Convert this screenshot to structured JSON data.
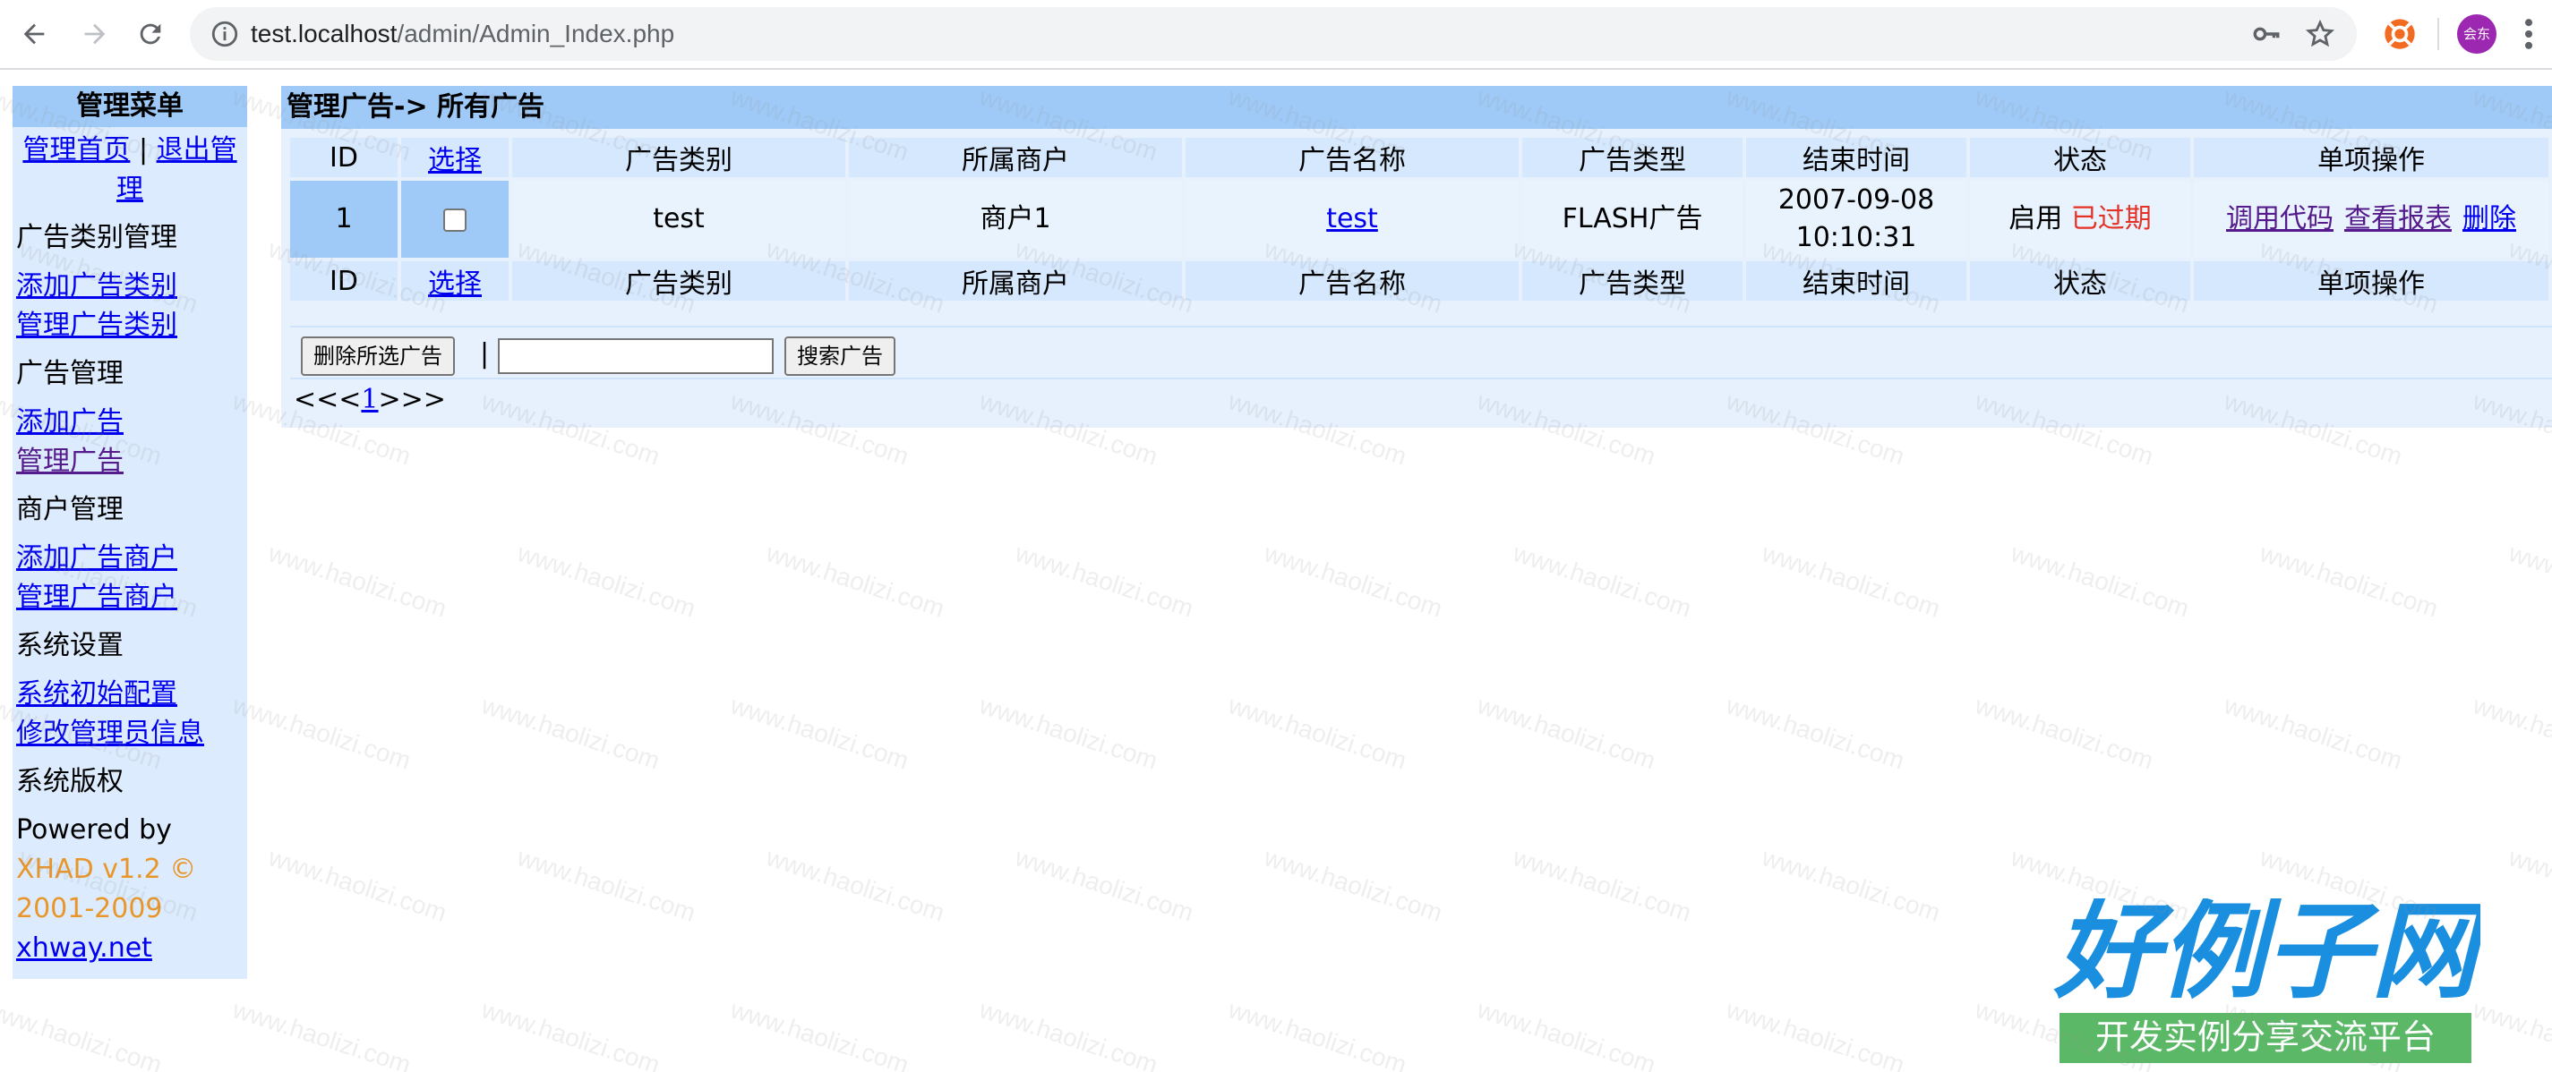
{
  "browser": {
    "url_host": "test.localhost",
    "url_path": "/admin/Admin_Index.php",
    "avatar_text": "会东",
    "icons": [
      "back-icon",
      "forward-icon",
      "reload-icon",
      "info-icon",
      "key-icon",
      "star-icon",
      "extension-icon",
      "menu-icon"
    ]
  },
  "watermark": "www.haolizi.com",
  "sidebar": {
    "title": "管理菜单",
    "home_link": "管理首页",
    "separator": "|",
    "logout_link": "退出管理",
    "sections": [
      {
        "heading": "广告类别管理",
        "links": [
          "添加广告类别",
          "管理广告类别"
        ]
      },
      {
        "heading": "广告管理",
        "links": [
          "添加广告",
          "管理广告"
        ]
      },
      {
        "heading": "商户管理",
        "links": [
          "添加广告商户",
          "管理广告商户"
        ]
      },
      {
        "heading": "系统设置",
        "links": [
          "系统初始配置",
          "修改管理员信息"
        ]
      }
    ],
    "copyright_heading": "系统版权",
    "powered_by": "Powered by",
    "product": "XHAD v1.2 ©",
    "years": "2001-2009",
    "site_link": "xhway.net"
  },
  "main": {
    "title": "管理广告-> 所有广告",
    "columns": [
      "ID",
      "选择",
      "广告类别",
      "所属商户",
      "广告名称",
      "广告类型",
      "结束时间",
      "状态",
      "单项操作"
    ],
    "rows": [
      {
        "id": "1",
        "category": "test",
        "merchant": "商户1",
        "name": "test",
        "type": "FLASH广告",
        "end_date": "2007-09-08",
        "end_time": "10:10:31",
        "status": "启用",
        "status_extra": "已过期",
        "ops": [
          "调用代码",
          "查看报表",
          "删除"
        ]
      }
    ],
    "delete_button": "删除所选广告",
    "pipe": "|",
    "search_value": "",
    "search_button": "搜索广告",
    "pager_prefix": "<<<",
    "pager_page": "1",
    "pager_suffix": ">>>"
  },
  "logo": {
    "title": "好例子网",
    "subtitle": "开发实例分享交流平台"
  },
  "colors": {
    "header_bg": "#9fcaf7",
    "cell_bg": "#d5e8fd",
    "panel_bg": "#e6f1fd",
    "link": "#0000ee",
    "visited": "#551a8b",
    "expired": "#e53227",
    "orange": "#e8962a",
    "logo_blue": "#1a8fe0",
    "logo_green": "#5bb866"
  }
}
